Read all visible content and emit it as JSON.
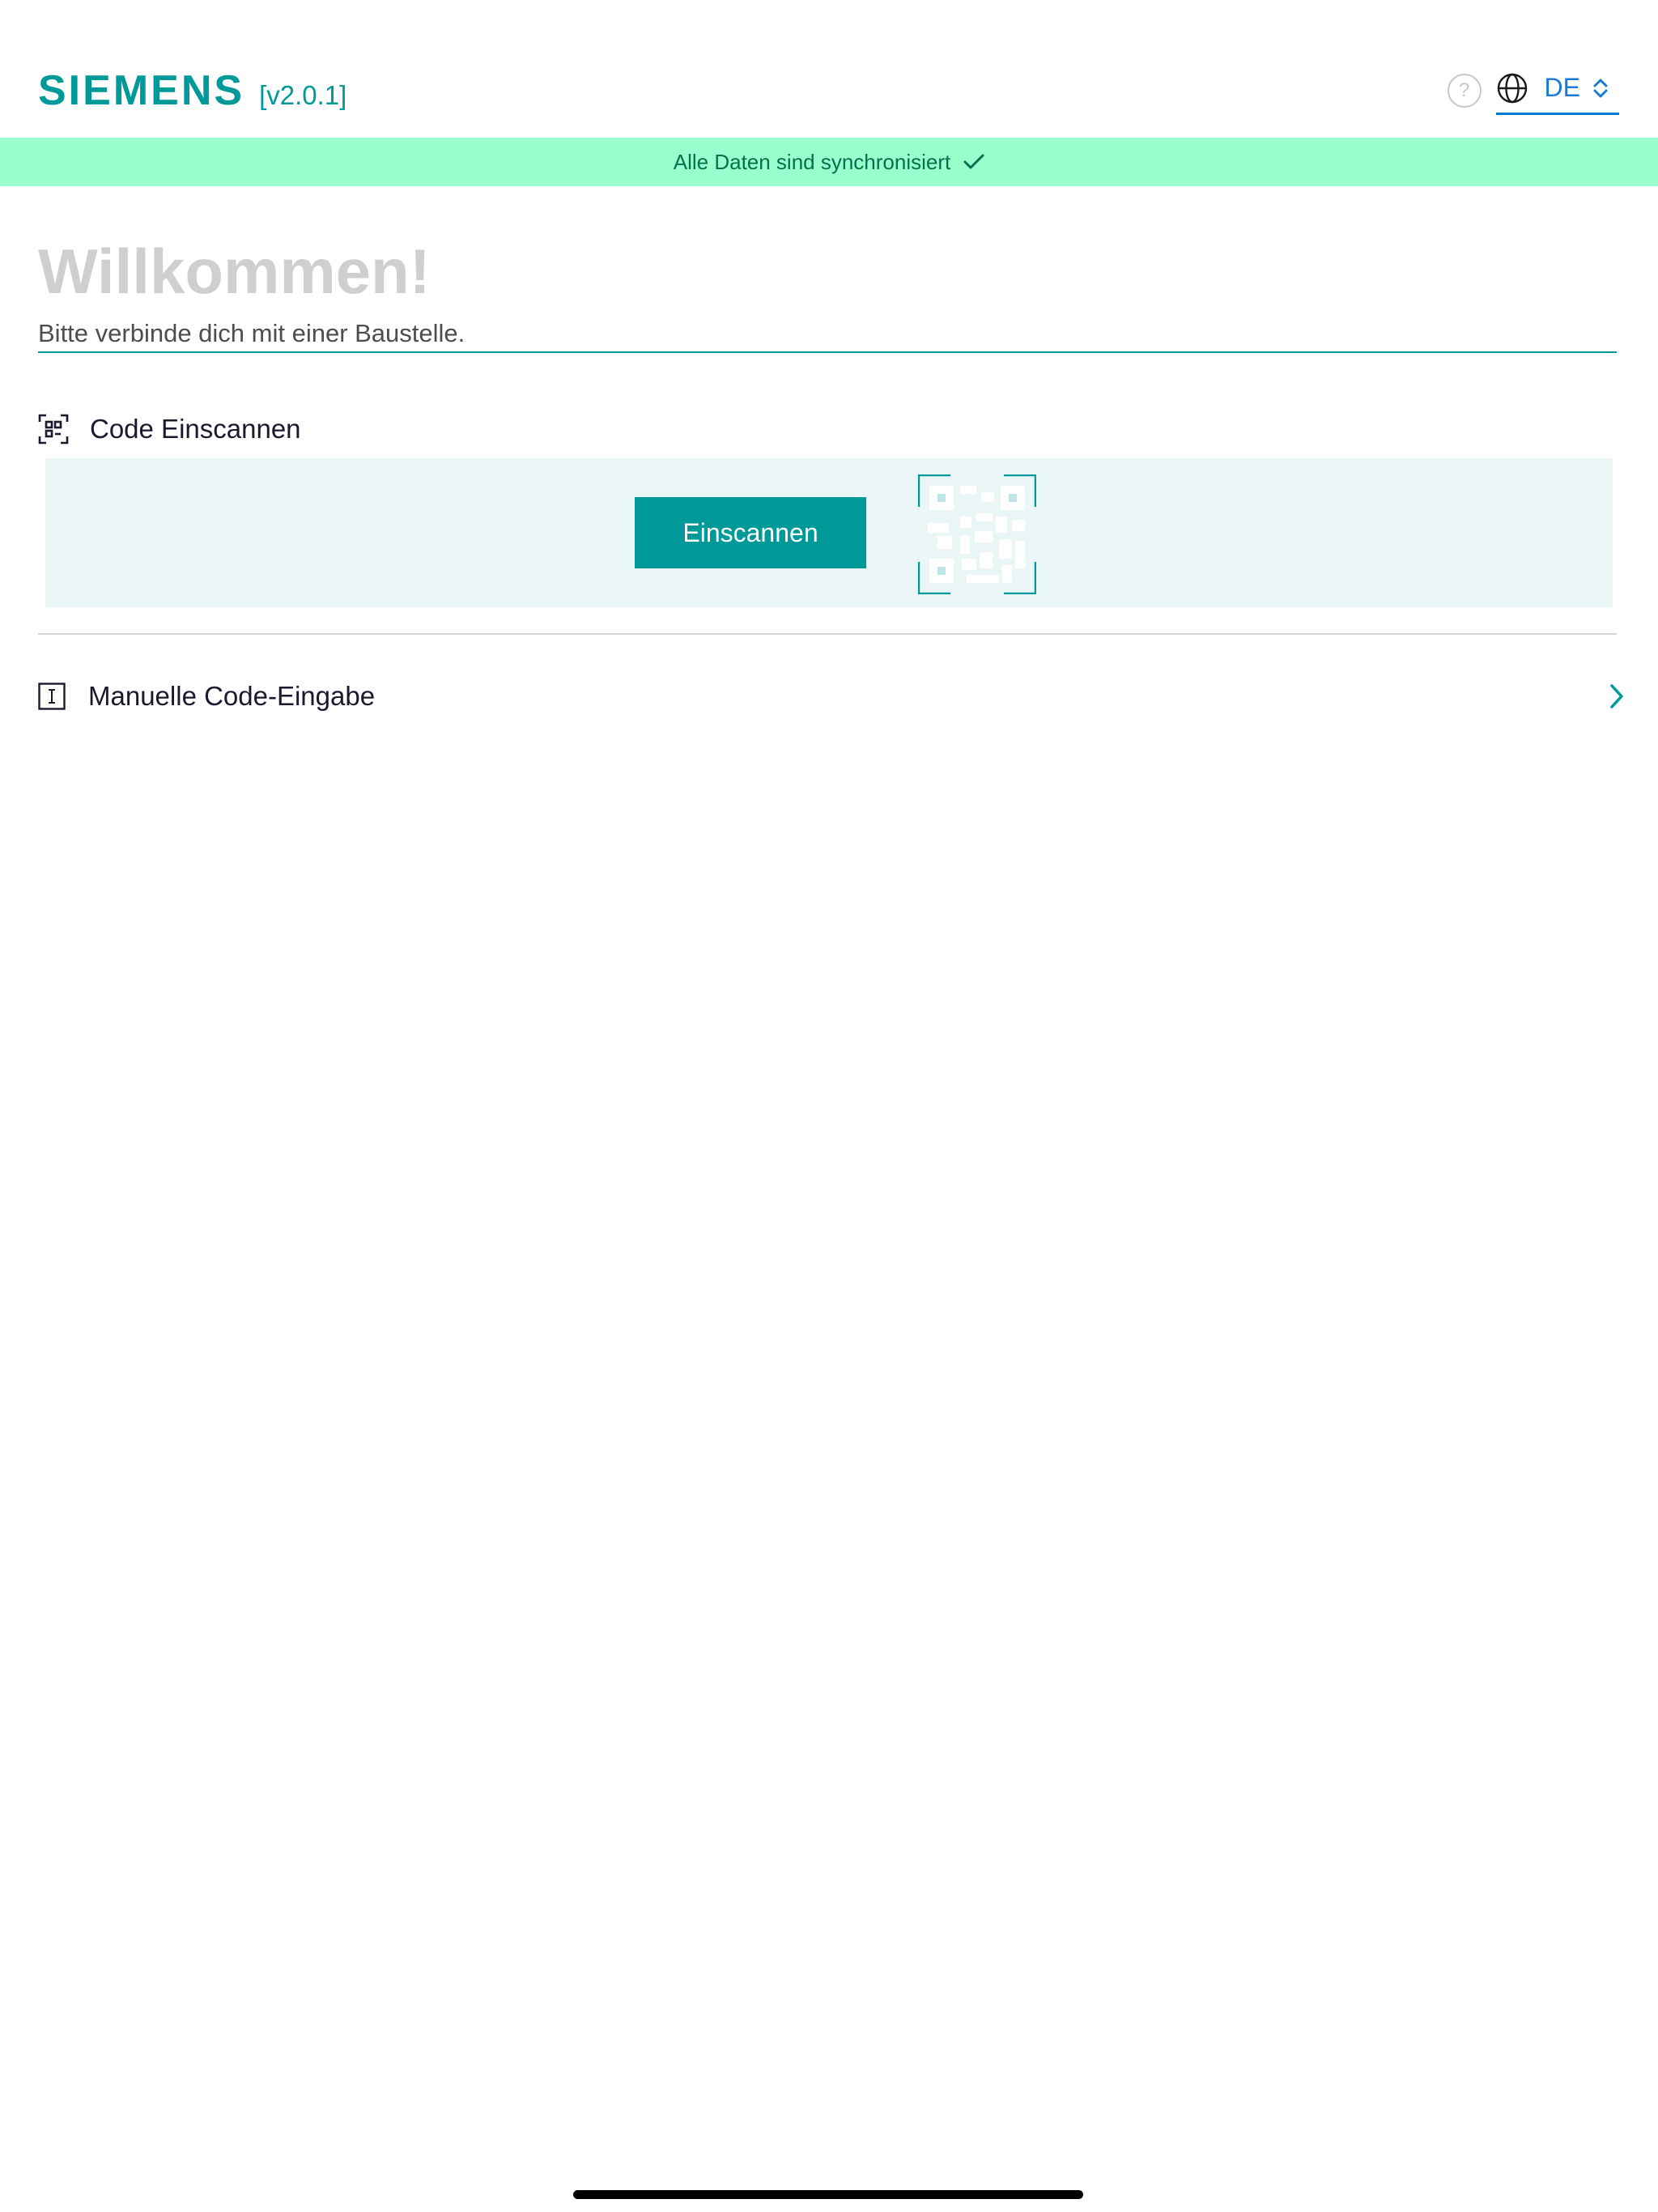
{
  "header": {
    "brand": "SIEMENS",
    "version": "[v2.0.1]",
    "help_symbol": "?",
    "language": "DE",
    "icons": [
      "help-icon",
      "globe-icon",
      "chevron-updown-icon"
    ]
  },
  "sync_banner": {
    "text": "Alle Daten sind synchronisiert",
    "icon": "check-icon"
  },
  "welcome": {
    "title": "Willkommen!",
    "subtitle": "Bitte verbinde dich mit einer Baustelle."
  },
  "scan_section": {
    "label": "Code Einscannen",
    "icon": "qr-scan-icon",
    "button_label": "Einscannen",
    "illustration": "qr-code-icon"
  },
  "manual_entry": {
    "label": "Manuelle Code-Eingabe",
    "icon": "text-cursor-icon",
    "chevron": "chevron-right-icon"
  },
  "colors": {
    "brand": "#009999",
    "banner_bg": "#99ffcc",
    "banner_text": "#00734d",
    "panel_bg": "#ebf7f7",
    "link_blue": "#1a7ad4",
    "title_gray": "#cfcfcf"
  }
}
